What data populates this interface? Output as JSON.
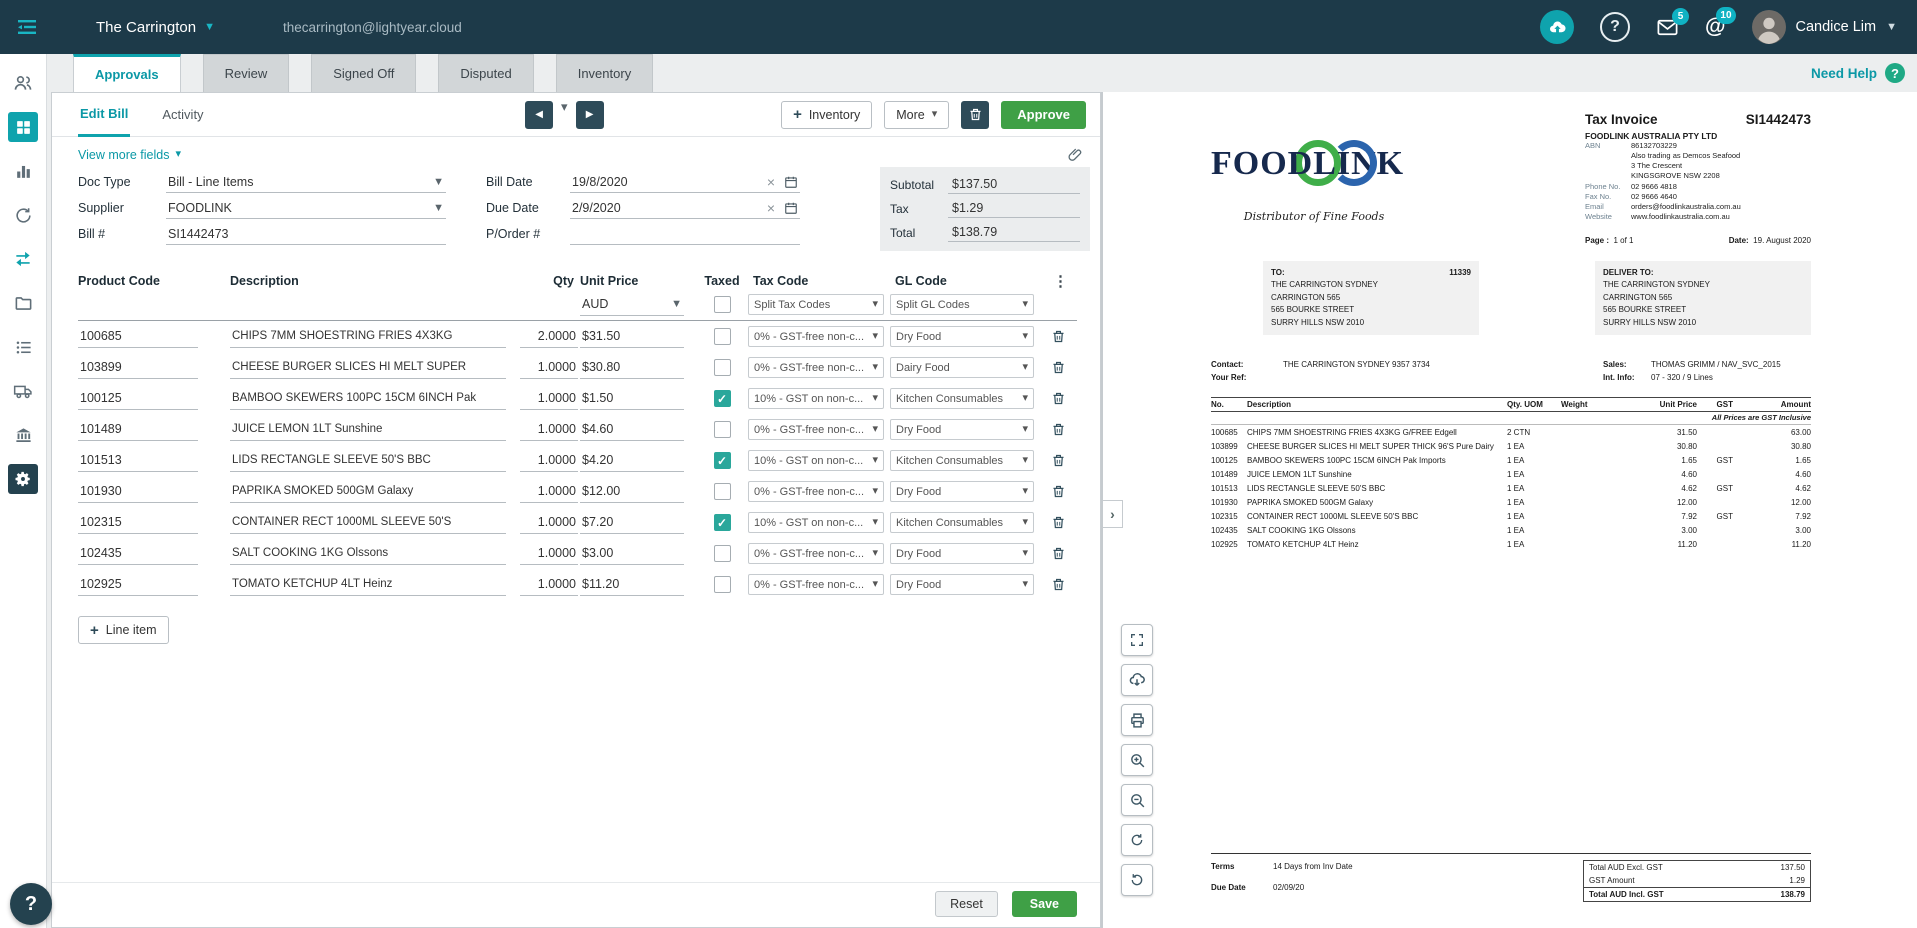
{
  "topbar": {
    "company": "The Carrington",
    "email": "thecarrington@lightyear.cloud",
    "mail_badge": "5",
    "mention_badge": "10",
    "user_name": "Candice Lim"
  },
  "tabs": {
    "items": [
      {
        "label": "Approvals"
      },
      {
        "label": "Review"
      },
      {
        "label": "Signed Off"
      },
      {
        "label": "Disputed"
      },
      {
        "label": "Inventory"
      }
    ],
    "need_help": "Need Help"
  },
  "editor": {
    "subtab_edit": "Edit Bill",
    "subtab_activity": "Activity",
    "inventory_button": "Inventory",
    "more_button": "More",
    "approve_button": "Approve",
    "view_more_fields": "View more fields",
    "fields": {
      "doc_type_label": "Doc Type",
      "doc_type_value": "Bill - Line Items",
      "supplier_label": "Supplier",
      "supplier_value": "FOODLINK",
      "bill_no_label": "Bill #",
      "bill_no_value": "SI1442473",
      "bill_date_label": "Bill Date",
      "bill_date_value": "19/8/2020",
      "due_date_label": "Due Date",
      "due_date_value": "2/9/2020",
      "po_label": "P/Order #",
      "po_value": ""
    },
    "totals": {
      "subtotal_label": "Subtotal",
      "subtotal_value": "$137.50",
      "tax_label": "Tax",
      "tax_value": "$1.29",
      "total_label": "Total",
      "total_value": "$138.79"
    },
    "table": {
      "headers": {
        "product_code": "Product Code",
        "description": "Description",
        "qty": "Qty",
        "unit_price": "Unit Price",
        "taxed": "Taxed",
        "tax_code": "Tax Code",
        "gl_code": "GL Code"
      },
      "currency": "AUD",
      "split_tax_codes": "Split Tax Codes",
      "split_gl_codes": "Split GL Codes",
      "rows": [
        {
          "code": "100685",
          "description": "CHIPS 7MM SHOESTRING FRIES 4X3KG",
          "qty": "2.0000",
          "unit_price": "$31.50",
          "taxed": false,
          "tax_code": "0% - GST-free non-c...",
          "gl_code": "Dry Food"
        },
        {
          "code": "103899",
          "description": "CHEESE BURGER SLICES HI MELT SUPER",
          "qty": "1.0000",
          "unit_price": "$30.80",
          "taxed": false,
          "tax_code": "0% - GST-free non-c...",
          "gl_code": "Dairy Food"
        },
        {
          "code": "100125",
          "description": "BAMBOO SKEWERS 100PC 15CM 6INCH Pak",
          "qty": "1.0000",
          "unit_price": "$1.50",
          "taxed": true,
          "tax_code": "10% - GST on non-c...",
          "gl_code": "Kitchen Consumables"
        },
        {
          "code": "101489",
          "description": "JUICE LEMON 1LT Sunshine",
          "qty": "1.0000",
          "unit_price": "$4.60",
          "taxed": false,
          "tax_code": "0% - GST-free non-c...",
          "gl_code": "Dry Food"
        },
        {
          "code": "101513",
          "description": "LIDS RECTANGLE SLEEVE 50'S BBC",
          "qty": "1.0000",
          "unit_price": "$4.20",
          "taxed": true,
          "tax_code": "10% - GST on non-c...",
          "gl_code": "Kitchen Consumables"
        },
        {
          "code": "101930",
          "description": "PAPRIKA SMOKED 500GM Galaxy",
          "qty": "1.0000",
          "unit_price": "$12.00",
          "taxed": false,
          "tax_code": "0% - GST-free non-c...",
          "gl_code": "Dry Food"
        },
        {
          "code": "102315",
          "description": "CONTAINER RECT 1000ML SLEEVE 50'S",
          "qty": "1.0000",
          "unit_price": "$7.20",
          "taxed": true,
          "tax_code": "10% - GST on non-c...",
          "gl_code": "Kitchen Consumables"
        },
        {
          "code": "102435",
          "description": "SALT COOKING 1KG Olssons",
          "qty": "1.0000",
          "unit_price": "$3.00",
          "taxed": false,
          "tax_code": "0% - GST-free non-c...",
          "gl_code": "Dry Food"
        },
        {
          "code": "102925",
          "description": "TOMATO KETCHUP 4LT Heinz",
          "qty": "1.0000",
          "unit_price": "$11.20",
          "taxed": false,
          "tax_code": "0% - GST-free non-c...",
          "gl_code": "Dry Food"
        }
      ]
    },
    "line_item_button": "Line item",
    "reset_button": "Reset",
    "save_button": "Save"
  },
  "invoice": {
    "title": "Tax Invoice",
    "number": "SI1442473",
    "supplier_name": "FOODLINK AUSTRALIA PTY LTD",
    "logo_text": "FOODLINK",
    "logo_tagline": "Distributor of Fine Foods",
    "supplier_info": [
      {
        "label": "ABN",
        "value": "86132703229"
      },
      {
        "label": "",
        "value": "Also trading as Demcos Seafood"
      },
      {
        "label": "",
        "value": "3 The Crescent"
      },
      {
        "label": "",
        "value": "KINGSGROVE NSW 2208"
      },
      {
        "label": "Phone No.",
        "value": "02 9666 4818"
      },
      {
        "label": "Fax No.",
        "value": "02 9666 4640"
      },
      {
        "label": "Email",
        "value": "orders@foodlinkaustralia.com.au"
      },
      {
        "label": "Website",
        "value": "www.foodlinkaustralia.com.au"
      }
    ],
    "page_label": "Page :",
    "page": "1 of 1",
    "date_label": "Date:",
    "date": "19. August 2020",
    "to_label": "TO:",
    "to_code": "11339",
    "to_address": "THE CARRINGTON SYDNEY\nCARRINGTON 565\n565 BOURKE STREET\nSURRY HILLS NSW 2010",
    "deliver_label": "DELIVER TO:",
    "deliver_address": "THE CARRINGTON SYDNEY\nCARRINGTON 565\n565 BOURKE STREET\nSURRY HILLS NSW 2010",
    "contact_label": "Contact:",
    "contact": "THE CARRINGTON SYDNEY  9357 3734",
    "your_ref_label": "Your Ref:",
    "your_ref": "",
    "sales_label": "Sales:",
    "sales": "THOMAS GRIMM  /  NAV_SVC_2015",
    "int_info_label": "Int. Info:",
    "int_info": "07 - 320  /  9 Lines",
    "gst_note": "All Prices are GST Inclusive",
    "table_headers": {
      "no": "No.",
      "description": "Description",
      "qty_uom": "Qty. UOM",
      "weight": "Weight",
      "unit_price": "Unit Price",
      "gst": "GST",
      "amount": "Amount"
    },
    "lines": [
      {
        "no": "100685",
        "description": "CHIPS 7MM SHOESTRING FRIES 4X3KG G/FREE Edgell",
        "qty_uom": "2 CTN",
        "weight": "",
        "unit_price": "31.50",
        "gst": "",
        "amount": "63.00"
      },
      {
        "no": "103899",
        "description": "CHEESE BURGER SLICES HI MELT SUPER THICK 96'S Pure Dairy",
        "qty_uom": "1 EA",
        "weight": "",
        "unit_price": "30.80",
        "gst": "",
        "amount": "30.80"
      },
      {
        "no": "100125",
        "description": "BAMBOO SKEWERS 100PC 15CM 6INCH Pak Imports",
        "qty_uom": "1 EA",
        "weight": "",
        "unit_price": "1.65",
        "gst": "GST",
        "amount": "1.65"
      },
      {
        "no": "101489",
        "description": "JUICE LEMON 1LT Sunshine",
        "qty_uom": "1 EA",
        "weight": "",
        "unit_price": "4.60",
        "gst": "",
        "amount": "4.60"
      },
      {
        "no": "101513",
        "description": "LIDS RECTANGLE SLEEVE 50'S BBC",
        "qty_uom": "1 EA",
        "weight": "",
        "unit_price": "4.62",
        "gst": "GST",
        "amount": "4.62"
      },
      {
        "no": "101930",
        "description": "PAPRIKA SMOKED 500GM Galaxy",
        "qty_uom": "1 EA",
        "weight": "",
        "unit_price": "12.00",
        "gst": "",
        "amount": "12.00"
      },
      {
        "no": "102315",
        "description": "CONTAINER RECT 1000ML SLEEVE 50'S BBC",
        "qty_uom": "1 EA",
        "weight": "",
        "unit_price": "7.92",
        "gst": "GST",
        "amount": "7.92"
      },
      {
        "no": "102435",
        "description": "SALT COOKING 1KG Olssons",
        "qty_uom": "1 EA",
        "weight": "",
        "unit_price": "3.00",
        "gst": "",
        "amount": "3.00"
      },
      {
        "no": "102925",
        "description": "TOMATO KETCHUP 4LT Heinz",
        "qty_uom": "1 EA",
        "weight": "",
        "unit_price": "11.20",
        "gst": "",
        "amount": "11.20"
      }
    ],
    "terms_label": "Terms",
    "terms": "14 Days from Inv Date",
    "due_date_label": "Due Date",
    "due_date": "02/09/20",
    "totals": [
      {
        "label": "Total AUD Excl. GST",
        "value": "137.50"
      },
      {
        "label": "GST Amount",
        "value": "1.29"
      },
      {
        "label": "Total AUD Incl. GST",
        "value": "138.79"
      }
    ]
  },
  "colors": {
    "accent_teal": "#0fa3ad",
    "action_green": "#3fa046",
    "topbar_bg": "#1d3a49"
  }
}
